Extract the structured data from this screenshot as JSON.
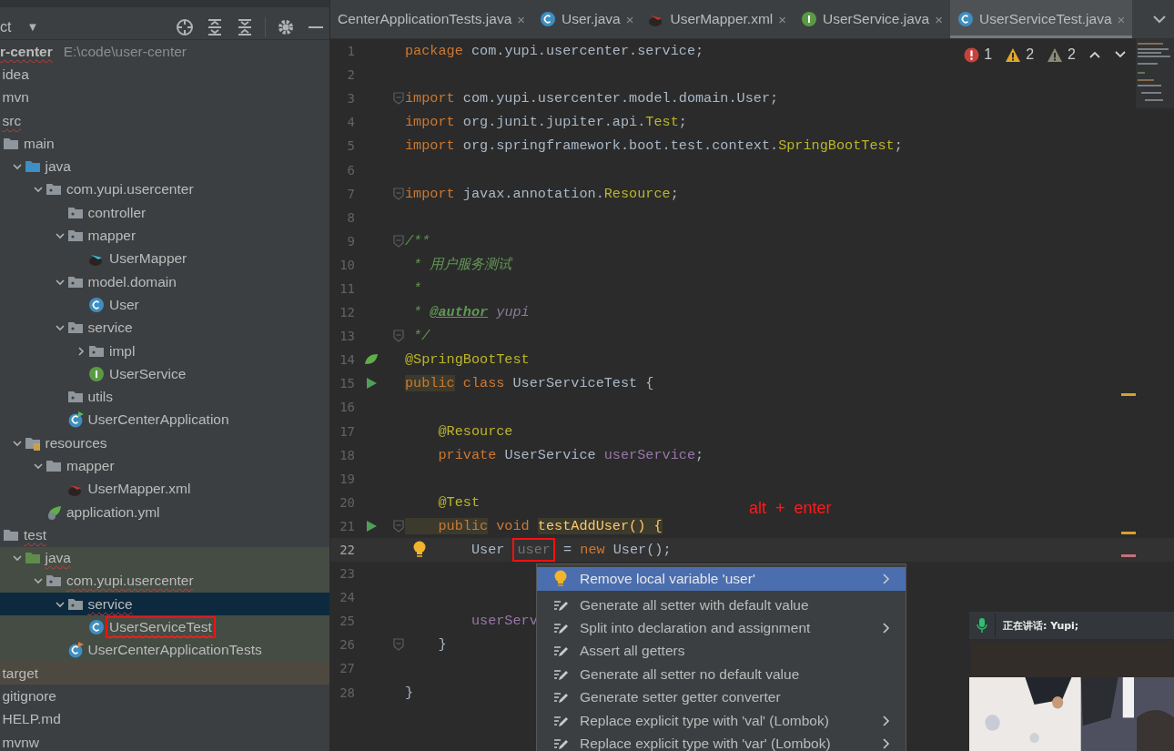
{
  "project_panel": {
    "title": "ct",
    "dropdown": "▼"
  },
  "tree": [
    {
      "label": "r-center",
      "path": "E:\\code\\user-center",
      "error": true,
      "children": [
        {
          "label": "idea"
        },
        {
          "label": "mvn"
        },
        {
          "label": "src",
          "error": true,
          "children": [
            {
              "label": "main",
              "kind": "folder",
              "children": [
                {
                  "label": "java",
                  "kind": "source",
                  "expanded": true,
                  "children": [
                    {
                      "label": "com.yupi.usercenter",
                      "kind": "package",
                      "expanded": true,
                      "children": [
                        {
                          "label": "controller",
                          "kind": "package"
                        },
                        {
                          "label": "mapper",
                          "kind": "package",
                          "expanded": true,
                          "children": [
                            {
                              "label": "UserMapper",
                              "kind": "mybatis"
                            }
                          ]
                        },
                        {
                          "label": "model.domain",
                          "kind": "package",
                          "expanded": true,
                          "children": [
                            {
                              "label": "User",
                              "kind": "class"
                            }
                          ]
                        },
                        {
                          "label": "service",
                          "kind": "package",
                          "expanded": true,
                          "children": [
                            {
                              "label": "impl",
                              "kind": "package",
                              "expanded": false
                            },
                            {
                              "label": "UserService",
                              "kind": "interface"
                            }
                          ]
                        },
                        {
                          "label": "utils",
                          "kind": "package"
                        },
                        {
                          "label": "UserCenterApplication",
                          "kind": "spring-app"
                        }
                      ]
                    }
                  ]
                },
                {
                  "label": "resources",
                  "kind": "resources",
                  "expanded": true,
                  "children": [
                    {
                      "label": "mapper",
                      "kind": "folder",
                      "expanded": true,
                      "children": [
                        {
                          "label": "UserMapper.xml",
                          "kind": "mybatis-xml"
                        }
                      ]
                    },
                    {
                      "label": "application.yml",
                      "kind": "spring-config"
                    }
                  ]
                }
              ]
            },
            {
              "label": "test",
              "kind": "folder",
              "error": true,
              "children": [
                {
                  "label": "java",
                  "kind": "test-source",
                  "expanded": true,
                  "in_test": true,
                  "error": true,
                  "children": [
                    {
                      "label": "com.yupi.usercenter",
                      "kind": "package",
                      "expanded": true,
                      "in_test": true,
                      "error": true,
                      "children": [
                        {
                          "label": "service",
                          "kind": "package",
                          "expanded": true,
                          "selected": true,
                          "error": true,
                          "children": [
                            {
                              "label": "UserServiceTest",
                              "kind": "class",
                              "in_test": true,
                              "error": true,
                              "marked": true
                            }
                          ]
                        },
                        {
                          "label": "UserCenterApplicationTests",
                          "kind": "spring-test",
                          "in_test": true
                        }
                      ]
                    }
                  ]
                }
              ]
            }
          ]
        },
        {
          "label": "target",
          "excluded": true
        },
        {
          "label": "gitignore"
        },
        {
          "label": "HELP.md"
        },
        {
          "label": "mvnw"
        }
      ]
    }
  ],
  "tabs": [
    {
      "label": "CenterApplicationTests.java",
      "selected": false,
      "close": "×"
    },
    {
      "label": "User.java",
      "kind": "class",
      "selected": false,
      "close": "×"
    },
    {
      "label": "UserMapper.xml",
      "kind": "mybatis-xml",
      "selected": false,
      "close": "×"
    },
    {
      "label": "UserService.java",
      "kind": "interface",
      "selected": false,
      "close": "×"
    },
    {
      "label": "UserServiceTest.java",
      "kind": "class",
      "selected": true,
      "close": "×"
    }
  ],
  "inspections": [
    {
      "kind": "error",
      "count": "1"
    },
    {
      "kind": "warning",
      "count": "2"
    },
    {
      "kind": "weak",
      "count": "2"
    }
  ],
  "lines": [
    {
      "number": "1",
      "current": false,
      "fold": false,
      "segments": [
        {
          "kind": "kw",
          "text": "package"
        },
        {
          "kind": "plain",
          "text": " com.yupi.usercenter.service;"
        }
      ]
    },
    {
      "number": "2",
      "current": false,
      "fold": false
    },
    {
      "number": "3",
      "current": false,
      "fold": true,
      "segments": [
        {
          "kind": "kw",
          "text": "import"
        },
        {
          "kind": "plain",
          "text": " com.yupi.usercenter.model.domain.User;"
        }
      ]
    },
    {
      "number": "4",
      "current": false,
      "fold": false,
      "segments": [
        {
          "kind": "kw",
          "text": "import"
        },
        {
          "kind": "plain",
          "text": " org.junit.jupiter.api."
        },
        {
          "kind": "ann",
          "text": "Test"
        },
        {
          "kind": "plain",
          "text": ";"
        }
      ]
    },
    {
      "number": "5",
      "current": false,
      "fold": false,
      "segments": [
        {
          "kind": "kw",
          "text": "import"
        },
        {
          "kind": "plain",
          "text": " org.springframework.boot.test.context."
        },
        {
          "kind": "ann",
          "text": "SpringBootTest"
        },
        {
          "kind": "plain",
          "text": ";"
        }
      ]
    },
    {
      "number": "6",
      "current": false,
      "fold": false
    },
    {
      "number": "7",
      "current": false,
      "fold": true,
      "segments": [
        {
          "kind": "kw",
          "text": "import"
        },
        {
          "kind": "plain",
          "text": " javax.annotation."
        },
        {
          "kind": "ann",
          "text": "Resource"
        },
        {
          "kind": "plain",
          "text": ";"
        }
      ]
    },
    {
      "number": "8",
      "current": false,
      "fold": false
    },
    {
      "number": "9",
      "current": false,
      "fold": true,
      "segments": [
        {
          "kind": "doc",
          "text": "/**"
        }
      ]
    },
    {
      "number": "10",
      "current": false,
      "fold": false,
      "segments": [
        {
          "kind": "doc",
          "text": " * 用户服务测试"
        }
      ]
    },
    {
      "number": "11",
      "current": false,
      "fold": false,
      "segments": [
        {
          "kind": "doc",
          "text": " *"
        }
      ]
    },
    {
      "number": "12",
      "current": false,
      "fold": false,
      "segments": [
        {
          "kind": "doc",
          "text": " * "
        },
        {
          "kind": "doc-tag",
          "text": "@author"
        },
        {
          "kind": "doc-value",
          "text": " yupi"
        }
      ]
    },
    {
      "number": "13",
      "current": false,
      "fold": true,
      "segments": [
        {
          "kind": "doc",
          "text": " */"
        }
      ]
    },
    {
      "number": "14",
      "current": false,
      "fold": false,
      "kind": "bean",
      "segments": [
        {
          "kind": "ann",
          "text": "@SpringBootTest"
        }
      ]
    },
    {
      "number": "15",
      "current": false,
      "fold": false,
      "kind": "run",
      "segments": [
        {
          "kind": "kw",
          "text": "public",
          "highlight": true
        },
        {
          "kind": "kw",
          "text": " class"
        },
        {
          "kind": "plain",
          "text": " UserServiceTest "
        },
        {
          "kind": "brace",
          "text": "{"
        }
      ]
    },
    {
      "number": "16",
      "current": false,
      "fold": false
    },
    {
      "number": "17",
      "current": false,
      "fold": false,
      "segments": [
        {
          "kind": "ann",
          "text": "    @Resource"
        }
      ]
    },
    {
      "number": "18",
      "current": false,
      "fold": false,
      "segments": [
        {
          "kind": "kw",
          "text": "    private"
        },
        {
          "kind": "plain",
          "text": " UserService "
        },
        {
          "kind": "field",
          "text": "userService"
        },
        {
          "kind": "plain",
          "text": ";"
        }
      ]
    },
    {
      "number": "19",
      "current": false,
      "fold": false
    },
    {
      "number": "20",
      "current": false,
      "fold": false,
      "segments": [
        {
          "kind": "ann",
          "text": "    @Test"
        }
      ]
    },
    {
      "number": "21",
      "current": false,
      "fold": true,
      "kind": "run",
      "segments": [
        {
          "kind": "kw",
          "text": "    public",
          "highlight": true
        },
        {
          "kind": "kw",
          "text": " void "
        },
        {
          "kind": "method",
          "text": "testAddUser() {",
          "highlight": true
        }
      ]
    },
    {
      "number": "22",
      "current": true,
      "fold": false,
      "kind": "bulb",
      "segments": [
        {
          "kind": "plain",
          "text": "        User "
        },
        {
          "kind": "unused",
          "text": "user",
          "marked": true
        },
        {
          "kind": "plain",
          "text": " = "
        },
        {
          "kind": "kw",
          "text": "new"
        },
        {
          "kind": "plain",
          "text": " User();"
        }
      ]
    },
    {
      "number": "23",
      "current": false,
      "fold": false
    },
    {
      "number": "24",
      "current": false,
      "fold": false
    },
    {
      "number": "25",
      "current": false,
      "fold": false,
      "segments": [
        {
          "kind": "field",
          "text": "        userServ"
        }
      ]
    },
    {
      "number": "26",
      "current": false,
      "fold": true,
      "segments": [
        {
          "kind": "brace",
          "text": "    }"
        }
      ]
    },
    {
      "number": "27",
      "current": false,
      "fold": false
    },
    {
      "number": "28",
      "current": false,
      "fold": false,
      "segments": [
        {
          "kind": "brace",
          "text": "}"
        }
      ]
    }
  ],
  "annotation": {
    "text": "alt  +  enter"
  },
  "popup": [
    {
      "label": "Remove local variable 'user'",
      "kind": "bulb",
      "submenu": true,
      "selected": true
    },
    {
      "label": "Generate all setter with default value",
      "kind": "intention",
      "submenu": false,
      "selected": false
    },
    {
      "label": "Split into declaration and assignment",
      "kind": "intention",
      "submenu": true,
      "selected": false
    },
    {
      "label": "Assert all getters",
      "kind": "intention",
      "submenu": false,
      "selected": false
    },
    {
      "label": "Generate all setter no default value",
      "kind": "intention",
      "submenu": false,
      "selected": false
    },
    {
      "label": "Generate setter getter converter",
      "kind": "intention",
      "submenu": false,
      "selected": false
    },
    {
      "label": "Replace explicit type with 'val' (Lombok)",
      "kind": "intention",
      "submenu": true,
      "selected": false
    },
    {
      "label": "Replace explicit type with 'var' (Lombok)",
      "kind": "intention",
      "submenu": true,
      "selected": false
    }
  ],
  "video": {
    "speaking": "正在讲话: Yupi;",
    "kind": "picture"
  }
}
